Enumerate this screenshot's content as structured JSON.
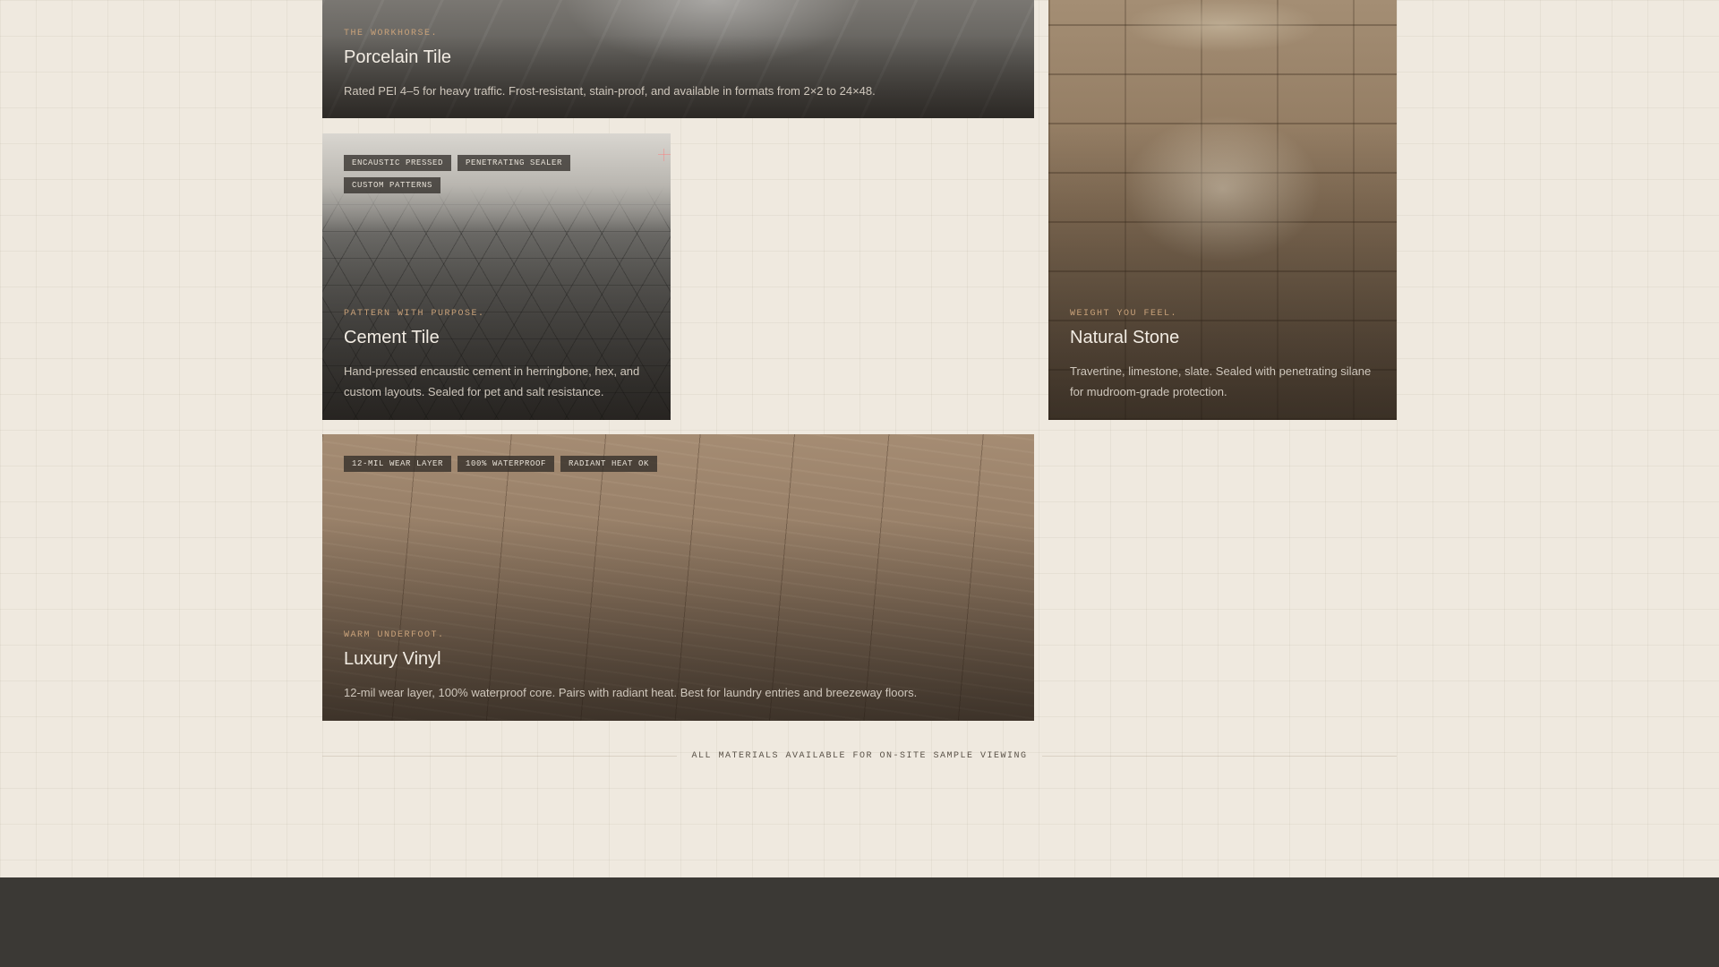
{
  "cards": [
    {
      "kicker": "The workhorse.",
      "title": "Porcelain Tile",
      "desc": "Rated PEI 4–5 for heavy traffic. Frost-resistant, stain-proof, and available in formats from 2×2 to 24×48."
    },
    {
      "kicker": "Pattern with purpose.",
      "title": "Cement Tile",
      "desc": "Hand-pressed encaustic cement in herringbone, hex, and custom layouts. Sealed for pet and salt resistance.",
      "tags": [
        "Encaustic pressed",
        "Penetrating sealer",
        "Custom patterns"
      ]
    },
    {
      "kicker": "Weight you feel.",
      "title": "Natural Stone",
      "desc": "Travertine, limestone, slate. Sealed with penetrating silane for mudroom-grade protection."
    },
    {
      "kicker": "Warm underfoot.",
      "title": "Luxury Vinyl",
      "desc": "12-mil wear layer, 100% waterproof core. Pairs with radiant heat. Best for laundry entries and breezeway floors.",
      "tags": [
        "12-mil wear layer",
        "100% waterproof",
        "Radiant heat OK"
      ]
    }
  ],
  "footnote": "All materials available for on-site sample viewing"
}
